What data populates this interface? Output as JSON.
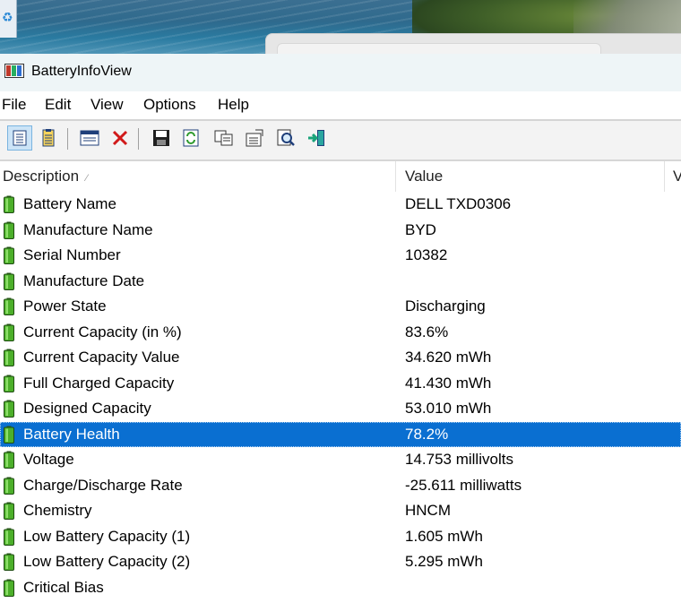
{
  "window": {
    "title": "BatteryInfoView"
  },
  "menu": [
    "File",
    "Edit",
    "View",
    "Options",
    "Help"
  ],
  "toolbar": {
    "buttons": [
      {
        "name": "properties-view-icon"
      },
      {
        "name": "list-view-icon"
      },
      {
        "name": "html-report-icon"
      },
      {
        "name": "delete-icon"
      },
      {
        "name": "save-icon"
      },
      {
        "name": "refresh-icon"
      },
      {
        "name": "copy-icon"
      },
      {
        "name": "properties-icon"
      },
      {
        "name": "find-icon"
      },
      {
        "name": "exit-icon"
      }
    ]
  },
  "columns": {
    "description": "Description",
    "value": "Value",
    "third": "V"
  },
  "rows": [
    {
      "description": "Battery Name",
      "value": "DELL TXD0306"
    },
    {
      "description": "Manufacture Name",
      "value": "BYD"
    },
    {
      "description": "Serial Number",
      "value": "10382"
    },
    {
      "description": "Manufacture Date",
      "value": ""
    },
    {
      "description": "Power State",
      "value": "Discharging"
    },
    {
      "description": "Current Capacity (in %)",
      "value": "83.6%"
    },
    {
      "description": "Current Capacity Value",
      "value": "34.620 mWh"
    },
    {
      "description": "Full Charged Capacity",
      "value": "41.430 mWh"
    },
    {
      "description": "Designed Capacity",
      "value": "53.010 mWh"
    },
    {
      "description": "Battery Health",
      "value": "78.2%",
      "selected": true
    },
    {
      "description": "Voltage",
      "value": "14.753 millivolts"
    },
    {
      "description": "Charge/Discharge Rate",
      "value": "-25.611 milliwatts"
    },
    {
      "description": "Chemistry",
      "value": "HNCM"
    },
    {
      "description": "Low Battery Capacity (1)",
      "value": "1.605 mWh"
    },
    {
      "description": "Low Battery Capacity (2)",
      "value": "5.295 mWh"
    },
    {
      "description": "Critical Bias",
      "value": ""
    }
  ],
  "colors": {
    "selection": "#0a6fd1",
    "battery_green": "#4caf2a"
  }
}
